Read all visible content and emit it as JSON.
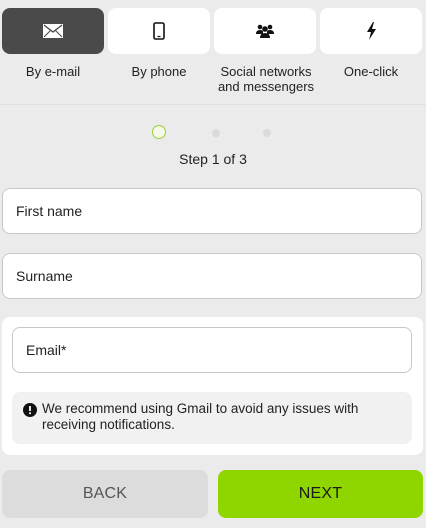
{
  "tabs": [
    {
      "label": "By e-mail",
      "icon": "envelope-icon",
      "active": true
    },
    {
      "label": "By phone",
      "icon": "phone-icon",
      "active": false
    },
    {
      "label": "Social networks and messengers",
      "icon": "users-icon",
      "active": false
    },
    {
      "label": "One-click",
      "icon": "lightning-icon",
      "active": false
    }
  ],
  "progress": {
    "text": "Step 1 of 3",
    "current": 1,
    "total": 3
  },
  "form": {
    "first_name_placeholder": "First name",
    "surname_placeholder": "Surname",
    "email_placeholder": "Email*",
    "notice": "We recommend using Gmail to avoid any issues with receiving notifications.",
    "notice_icon": "exclamation-circle-icon"
  },
  "buttons": {
    "back": "BACK",
    "next": "NEXT"
  },
  "colors": {
    "accent": "#8fd600",
    "active_tab": "#4a4a4a",
    "step_active": "#9ccf2c"
  }
}
